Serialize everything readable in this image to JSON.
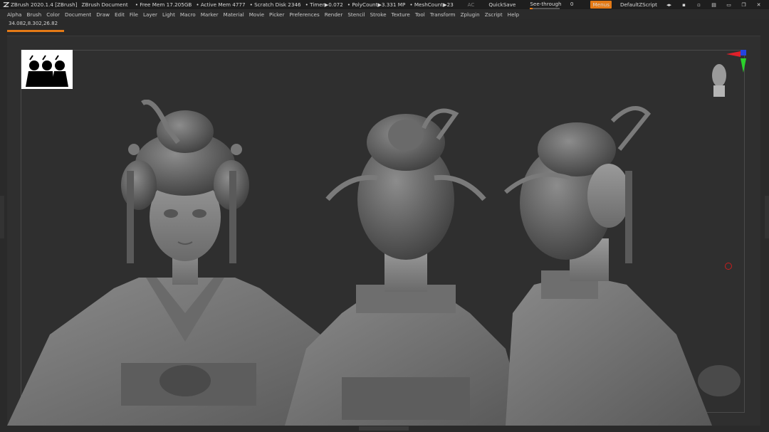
{
  "titlebar": {
    "app": "ZBrush 2020.1.4 [ZBrush]",
    "document": "ZBrush Document",
    "free_mem": "• Free Mem 17.205GB",
    "active_mem": "• Active Mem 4777",
    "scratch": "• Scratch Disk 2346",
    "timer": "• Timer▶0.072",
    "polycount": "• PolyCount▶3.331 MP",
    "meshcount": "• MeshCount▶23",
    "ac": "AC",
    "quicksave": "QuickSave",
    "seethrough_label": "See-through",
    "seethrough_value": "0",
    "menus": "Menus",
    "script": "DefaultZScript"
  },
  "menu": [
    "Alpha",
    "Brush",
    "Color",
    "Document",
    "Draw",
    "Edit",
    "File",
    "Layer",
    "Light",
    "Macro",
    "Marker",
    "Material",
    "Movie",
    "Picker",
    "Preferences",
    "Render",
    "Stencil",
    "Stroke",
    "Texture",
    "Tool",
    "Transform",
    "Zplugin",
    "Zscript",
    "Help"
  ],
  "coords": "34.082,8.302,26.82",
  "colors": {
    "accent": "#e47a16",
    "background": "#2f2f2f",
    "gizmo_x": "#e0202a",
    "gizmo_y": "#2bd12b",
    "gizmo_z": "#2444e0"
  },
  "icons": [
    "zbrush-logo-icon",
    "lock-icon",
    "layout-icon",
    "window-restore-icon",
    "window-close-icon"
  ]
}
